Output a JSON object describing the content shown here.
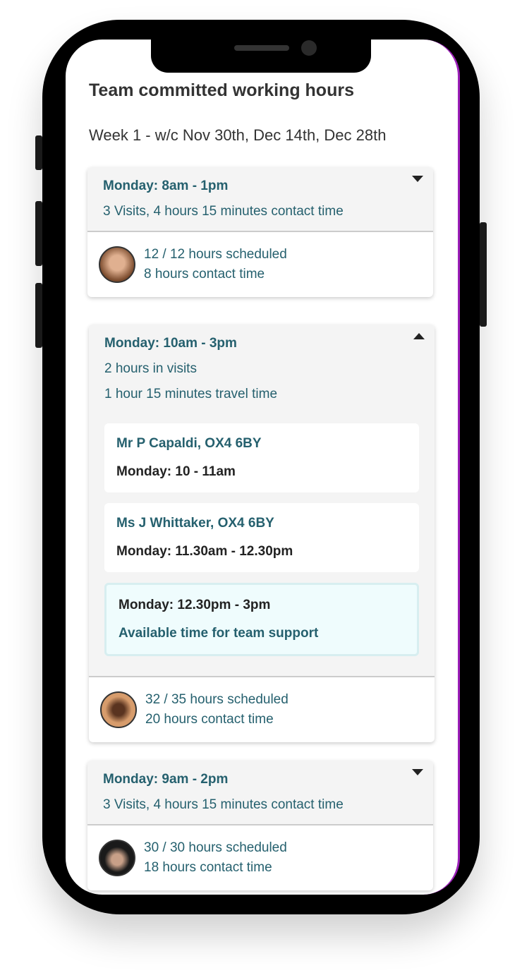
{
  "title": "Team committed working hours",
  "week": "Week 1 - w/c Nov 30th, Dec 14th, Dec 28th",
  "cards": [
    {
      "title": "Monday: 8am - 1pm",
      "lines": [
        "3 Visits, 4 hours 15 minutes contact time"
      ],
      "expanded": false,
      "scheduled": "12 / 12 hours scheduled",
      "contact": "8 hours contact time",
      "avatar_color": "#8a5a3c"
    },
    {
      "title": "Monday: 10am - 3pm",
      "lines": [
        "2 hours in visits",
        "1 hour 15 minutes travel time"
      ],
      "expanded": true,
      "visits": [
        {
          "name": "Mr P Capaldi, OX4 6BY",
          "time": "Monday: 10 - 11am"
        },
        {
          "name": "Ms J Whittaker, OX4 6BY",
          "time": "Monday: 11.30am - 12.30pm"
        }
      ],
      "available": {
        "time": "Monday: 12.30pm - 3pm",
        "label": "Available time for team support"
      },
      "scheduled": "32 / 35 hours scheduled",
      "contact": "20 hours contact time",
      "avatar_color": "#c98d5c"
    },
    {
      "title": "Monday: 9am - 2pm",
      "lines": [
        "3 Visits, 4 hours 15 minutes contact time"
      ],
      "expanded": false,
      "scheduled": "30 / 30 hours scheduled",
      "contact": "18 hours contact time",
      "avatar_color": "#2b2b2b"
    }
  ],
  "colors": {
    "accent": "#25606e",
    "available_bg": "#effcfd"
  }
}
